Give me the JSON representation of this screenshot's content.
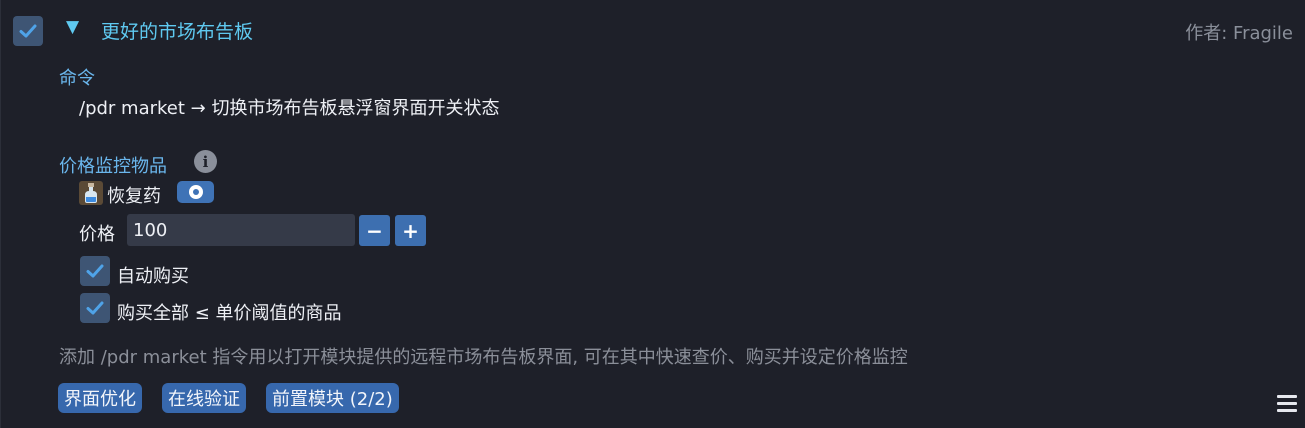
{
  "header": {
    "enabled": true,
    "expanded": true,
    "arrow": "▼",
    "title": "更好的市场布告板",
    "author": "作者: Fragile"
  },
  "commands": {
    "label": "命令",
    "line": "/pdr market → 切换市场布告板悬浮窗界面开关状态"
  },
  "monitor": {
    "label": "价格监控物品",
    "item_icon": "potion-icon",
    "item_name": "恢复药",
    "price_label": "价格",
    "price_value": "100",
    "decrement": "−",
    "increment": "+",
    "auto_buy": {
      "checked": true,
      "label": "自动购买"
    },
    "buy_all": {
      "checked": true,
      "label": "购买全部 ≤ 单价阈值的商品"
    }
  },
  "description": "添加 /pdr market 指令用以打开模块提供的远程市场布告板界面, 可在其中快速查价、购买并设定价格监控",
  "tags": [
    "界面优化",
    "在线验证",
    "前置模块 (2/2)"
  ],
  "colors": {
    "accent": "#5fc9f0",
    "section": "#6ab6ec",
    "button": "#3d6fb0",
    "checkbox": "#3e5574"
  }
}
